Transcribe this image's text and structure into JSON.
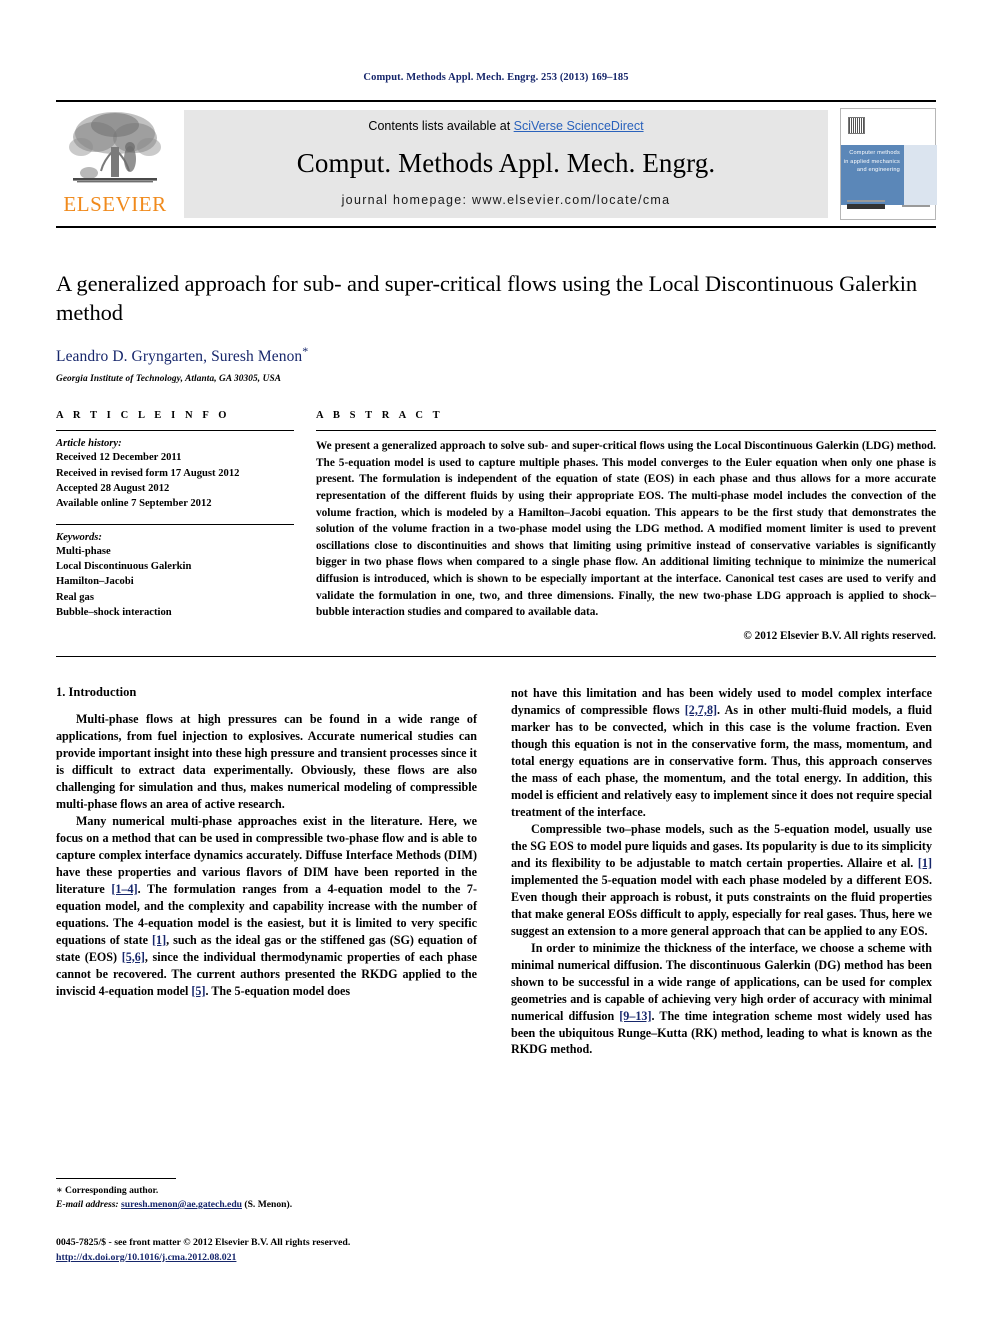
{
  "running_head": "Comput. Methods Appl. Mech. Engrg. 253 (2013) 169–185",
  "masthead": {
    "publisher_name": "ELSEVIER",
    "contents_prefix": "Contents lists available at ",
    "contents_link": "SciVerse ScienceDirect",
    "journal_name": "Comput. Methods Appl. Mech. Engrg.",
    "homepage": "journal homepage: www.elsevier.com/locate/cma",
    "cover_title": "Computer methods in applied mechanics and engineering"
  },
  "title": "A generalized approach for sub- and super-critical flows using the Local Discontinuous Galerkin method",
  "authors": "Leandro D. Gryngarten, Suresh Menon",
  "author_star": "*",
  "affiliation": "Georgia Institute of Technology, Atlanta, GA 30305, USA",
  "article_info": {
    "heading": "A R T I C L E    I N F O",
    "history_label": "Article history:",
    "history": [
      "Received 12 December 2011",
      "Received in revised form 17 August 2012",
      "Accepted 28 August 2012",
      "Available online 7 September 2012"
    ],
    "keywords_label": "Keywords:",
    "keywords": [
      "Multi-phase",
      "Local Discontinuous Galerkin",
      "Hamilton–Jacobi",
      "Real gas",
      "Bubble–shock interaction"
    ]
  },
  "abstract": {
    "heading": "A B S T R A C T",
    "text": "We present a generalized approach to solve sub- and super-critical flows using the Local Discontinuous Galerkin (LDG) method. The 5-equation model is used to capture multiple phases. This model converges to the Euler equation when only one phase is present. The formulation is independent of the equation of state (EOS) in each phase and thus allows for a more accurate representation of the different fluids by using their appropriate EOS. The multi-phase model includes the convection of the volume fraction, which is modeled by a Hamilton–Jacobi equation. This appears to be the first study that demonstrates the solution of the volume fraction in a two-phase model using the LDG method. A modified moment limiter is used to prevent oscillations close to discontinuities and shows that limiting using primitive instead of conservative variables is significantly bigger in two phase flows when compared to a single phase flow. An additional limiting technique to minimize the numerical diffusion is introduced, which is shown to be especially important at the interface. Canonical test cases are used to verify and validate the formulation in one, two, and three dimensions. Finally, the new two-phase LDG approach is applied to shock–bubble interaction studies and compared to available data.",
    "copyright": "© 2012 Elsevier B.V. All rights reserved."
  },
  "body": {
    "section_title": "1. Introduction",
    "left_paragraphs": [
      {
        "parts": [
          {
            "t": "Multi-phase flows at high pressures can be found in a wide range of applications, from fuel injection to explosives. Accurate numerical studies can provide important insight into these high pressure and transient processes since it is difficult to extract data experimentally. Obviously, these flows are also challenging for simulation and thus, makes numerical modeling of compressible multi-phase flows an area of active research."
          }
        ]
      },
      {
        "parts": [
          {
            "t": "Many numerical multi-phase approaches exist in the literature. Here, we focus on a method that can be used in compressible two-phase flow and is able to capture complex interface dynamics accurately. Diffuse Interface Methods (DIM) have these properties and various flavors of DIM have been reported in the literature "
          },
          {
            "t": "[1–4]",
            "ref": true
          },
          {
            "t": ". The formulation ranges from a 4-equation model to the 7-equation model, and the complexity and capability increase with the number of equations. The 4-equation model is the easiest, but it is limited to very specific equations of state "
          },
          {
            "t": "[1]",
            "ref": true
          },
          {
            "t": ", such as the ideal gas or the stiffened gas (SG) equation of state (EOS) "
          },
          {
            "t": "[5,6]",
            "ref": true
          },
          {
            "t": ", since the individual thermodynamic properties of each phase cannot be recovered. The current authors presented the RKDG applied to the inviscid 4-equation model "
          },
          {
            "t": "[5]",
            "ref": true
          },
          {
            "t": ". The 5-equation model does"
          }
        ]
      }
    ],
    "right_paragraphs": [
      {
        "no_indent": true,
        "parts": [
          {
            "t": "not have this limitation and has been widely used to model complex interface dynamics of compressible flows "
          },
          {
            "t": "[2,7,8]",
            "ref": true
          },
          {
            "t": ". As in other multi-fluid models, a fluid marker has to be convected, which in this case is the volume fraction. Even though this equation is not in the conservative form, the mass, momentum, and total energy equations are in conservative form. Thus, this approach conserves the mass of each phase, the momentum, and the total energy. In addition, this model is efficient and relatively easy to implement since it does not require special treatment of the interface."
          }
        ]
      },
      {
        "parts": [
          {
            "t": "Compressible two–phase models, such as the 5-equation model, usually use the SG EOS to model pure liquids and gases. Its popularity is due to its simplicity and its flexibility to be adjustable to match certain properties. Allaire et al. "
          },
          {
            "t": "[1]",
            "ref": true
          },
          {
            "t": " implemented the 5-equation model with each phase modeled by a different EOS. Even though their approach is robust, it puts constraints on the fluid properties that make general EOSs difficult to apply, especially for real gases. Thus, here we suggest an extension to a more general approach that can be applied to any EOS."
          }
        ]
      },
      {
        "parts": [
          {
            "t": "In order to minimize the thickness of the interface, we choose a scheme with minimal numerical diffusion. The discontinuous Galerkin (DG) method has been shown to be successful in a wide range of applications, can be used for complex geometries and is capable of achieving very high order of accuracy with minimal numerical diffusion "
          },
          {
            "t": "[9–13]",
            "ref": true
          },
          {
            "t": ". The time integration scheme most widely used has been the ubiquitous Runge–Kutta (RK) method, leading to what is known as the RKDG method."
          }
        ]
      }
    ]
  },
  "footnote": {
    "corresponding": "∗ Corresponding author.",
    "email_label": "E-mail address:",
    "email": "suresh.menon@ae.gatech.edu",
    "email_suffix": " (S. Menon)."
  },
  "footer": {
    "issn_line": "0045-7825/$ - see front matter © 2012 Elsevier B.V. All rights reserved.",
    "doi": "http://dx.doi.org/10.1016/j.cma.2012.08.021"
  },
  "colors": {
    "link_blue": "#2a62bc",
    "navy": "#16266b",
    "elsevier_orange": "#f08a1c",
    "cover_band": "#5b87b8"
  }
}
